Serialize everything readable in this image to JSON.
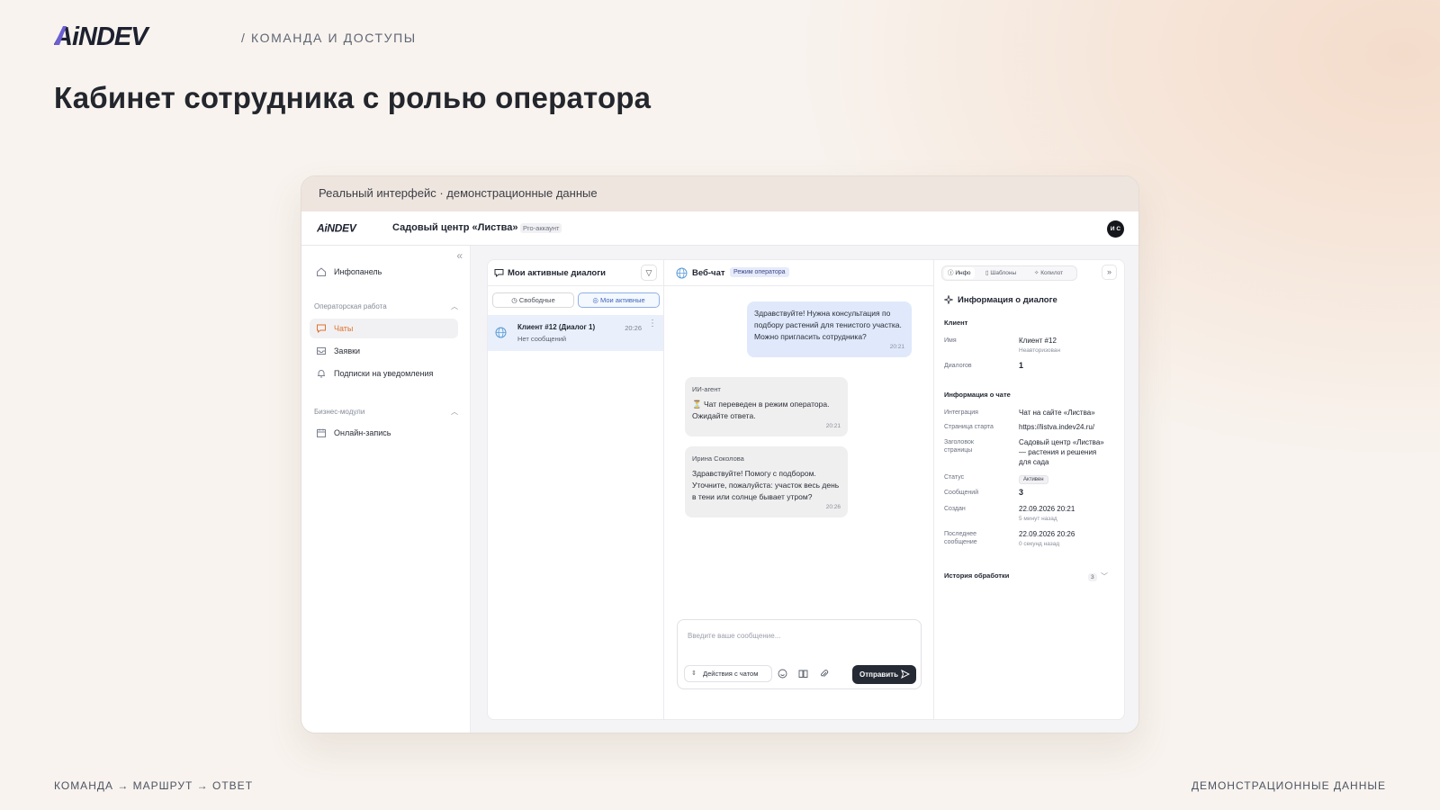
{
  "brand": {
    "logo_text": "AiNDEV"
  },
  "header": {
    "crumb": "/ КОМАНДА И ДОСТУПЫ",
    "title": "Кабинет сотрудника с ролью оператора"
  },
  "footer": {
    "left": "КОМАНДА → МАРШРУТ → ОТВЕТ",
    "right": "ДЕМОНСТРАЦИОННЫЕ ДАННЫЕ"
  },
  "frame": {
    "caption": "Реальный интерфейс · демонстрационные данные"
  },
  "app": {
    "logo_text": "AiNDEV",
    "company": "Садовый центр «Листва»",
    "plan": "Pro-аккаунт",
    "avatar_initials": "И С",
    "accent_color": "#e0722c"
  },
  "sidebar": {
    "dashboard": "Инфопанель",
    "group_operator": "Операторская работа",
    "chats": "Чаты",
    "requests": "Заявки",
    "subscriptions": "Подписки на уведомления",
    "group_business": "Бизнес-модули",
    "booking": "Онлайн-запись"
  },
  "dialogs": {
    "title": "Мои активные диалоги",
    "filter_free": "Свободные",
    "filter_mine": "Мои активные",
    "items": [
      {
        "title": "Клиент #12 (Диалог 1)",
        "subtitle": "Нет сообщений",
        "time": "20:26"
      }
    ]
  },
  "chat": {
    "title": "Веб-чат",
    "mode": "Режим оператора",
    "messages": [
      {
        "author": "",
        "text": "Здравствуйте! Нужна консультация по подбору растений для тенистого участка. Можно пригласить сотрудника?",
        "time": "20:21"
      },
      {
        "author": "ИИ-агент",
        "text": "⏳ Чат переведен в режим оператора. Ожидайте ответа.",
        "time": "20:21"
      },
      {
        "author": "Ирина Соколова",
        "text": "Здравствуйте! Помогу с подбором. Уточните, пожалуйста: участок весь день в тени или солнце бывает утром?",
        "time": "20:26"
      }
    ],
    "placeholder": "Введите ваше сообщение...",
    "actions": "Действия с чатом",
    "send": "Отправить"
  },
  "info": {
    "tabs": [
      "Инфо",
      "Шаблоны",
      "Копилот"
    ],
    "title": "Информация о диалоге",
    "client_section": "Клиент",
    "name_label": "Имя",
    "name_value": "Клиент #12",
    "name_sub": "Неавторизован",
    "dialogs_label": "Диалогов",
    "dialogs_value": "1",
    "chat_section": "Информация о чате",
    "integration_label": "Интеграция",
    "integration_value": "Чат на сайте «Листва»",
    "start_page_label": "Страница старта",
    "start_page_value": "https://listva.indev24.ru/",
    "page_title_label": "Заголовок страницы",
    "page_title_value": "Садовый центр «Листва» — растения и решения для сада",
    "status_label": "Статус",
    "status_value": "Активен",
    "messages_label": "Сообщений",
    "messages_value": "3",
    "created_label": "Создан",
    "created_value": "22.09.2026 20:21",
    "created_sub": "5 минут назад",
    "last_label": "Последнее сообщение",
    "last_value": "22.09.2026 20:26",
    "last_sub": "0 секунд назад",
    "history_label": "История обработки",
    "history_count": "3"
  }
}
